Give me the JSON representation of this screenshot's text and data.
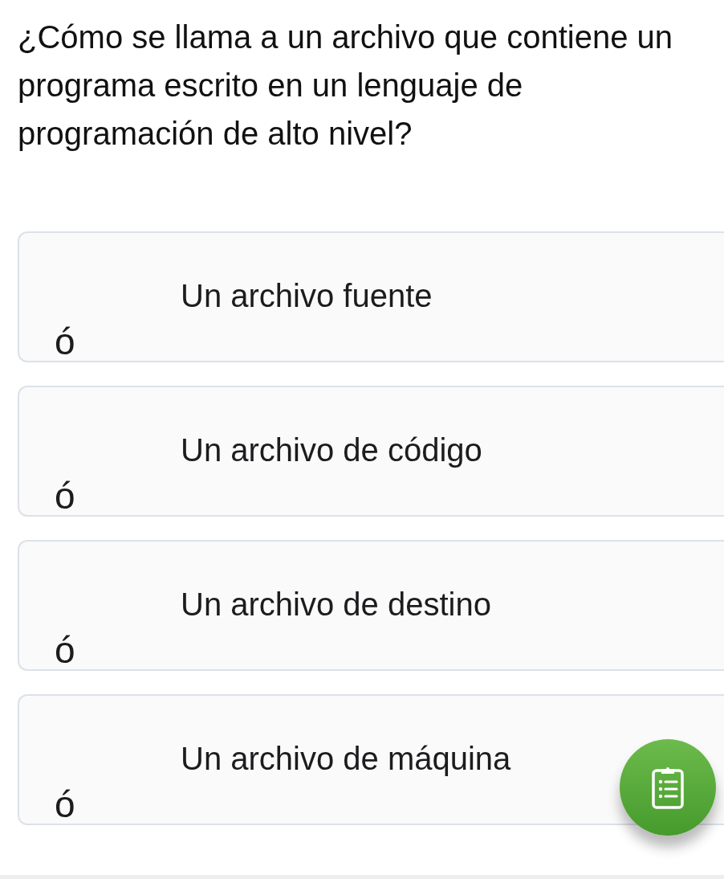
{
  "question": "¿Cómo se llama a un archivo que contiene un programa escrito en un lenguaje de programación de alto nivel?",
  "options": [
    {
      "text": "Un archivo fuente",
      "marker": "ó"
    },
    {
      "text": "Un archivo de código",
      "marker": "ó"
    },
    {
      "text": "Un archivo de destino",
      "marker": "ó"
    },
    {
      "text": "Un archivo de máquina",
      "marker": "ó"
    }
  ],
  "fab": {
    "kind": "clipboard"
  }
}
